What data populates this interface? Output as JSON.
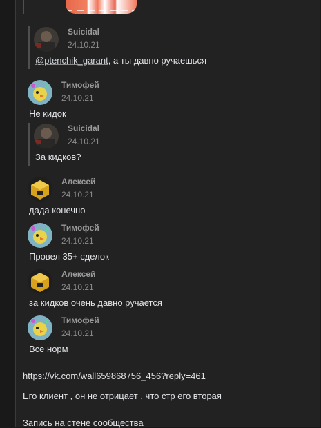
{
  "thread": {
    "sticker_icon": "sushi-sticker",
    "items": [
      {
        "author": "Suicidal",
        "date": "24.10.21",
        "mention": "@ptenchik_garant",
        "text": ", а ты давно ручаешься",
        "avatar": "suicidal-avatar"
      },
      {
        "author": "Тимофей",
        "date": "24.10.21",
        "text": "Не кидок",
        "avatar": "chick-avatar"
      },
      {
        "author": "Suicidal",
        "date": "24.10.21",
        "text": "За кидков?",
        "avatar": "suicidal-avatar"
      },
      {
        "author": "Алексей",
        "date": "24.10.21",
        "text": "дада конечно",
        "avatar": "cube-avatar"
      },
      {
        "author": "Тимофей",
        "date": "24.10.21",
        "text": "Провел 35+ сделок",
        "avatar": "chick-avatar"
      },
      {
        "author": "Алексей",
        "date": "24.10.21",
        "text": "за кидков очень давно ручается",
        "avatar": "cube-avatar"
      },
      {
        "author": "Тимофей",
        "date": "24.10.21",
        "text": "Все норм",
        "avatar": "chick-avatar"
      }
    ]
  },
  "post": {
    "link": "https://vk.com/wall659868756_456?reply=461",
    "comment": "Его клиент , он не отрицает , что стр его вторая",
    "footer": "Запись на стене сообщества"
  },
  "colors": {
    "background": "#191919",
    "panel": "#222222",
    "text": "#e1e3e6",
    "meta": "#8a8a8a"
  }
}
